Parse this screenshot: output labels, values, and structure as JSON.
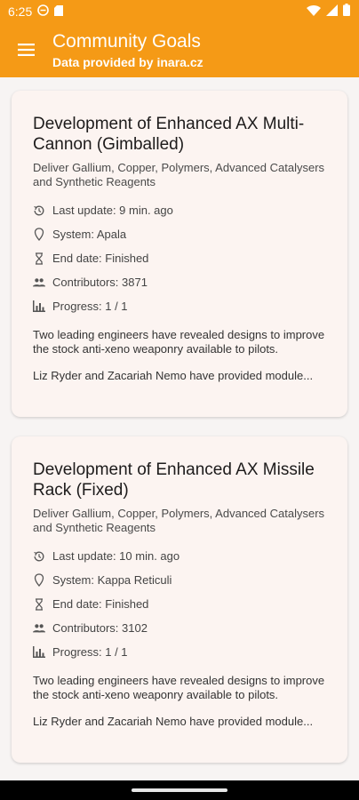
{
  "status": {
    "time": "6:25"
  },
  "header": {
    "title": "Community Goals",
    "subtitle": "Data provided by inara.cz"
  },
  "colors": {
    "accent": "#f59a16",
    "card": "#fcf4f1"
  },
  "goals": [
    {
      "title": "Development of Enhanced AX Multi-Cannon (Gimballed)",
      "description": "Deliver Gallium, Copper, Polymers, Advanced Catalysers and Synthetic Reagents",
      "last_update": "Last update: 9 min. ago",
      "system": "System: Apala",
      "end_date": "End date: Finished",
      "contributors": "Contributors: 3871",
      "progress": "Progress: 1 / 1",
      "body": "Two leading engineers have revealed designs to improve the stock anti-xeno weaponry available to pilots.",
      "body2": "Liz Ryder and Zacariah Nemo have provided module..."
    },
    {
      "title": "Development of Enhanced AX Missile Rack (Fixed)",
      "description": "Deliver Gallium, Copper, Polymers, Advanced Catalysers and Synthetic Reagents",
      "last_update": "Last update: 10 min. ago",
      "system": "System: Kappa Reticuli",
      "end_date": "End date: Finished",
      "contributors": "Contributors: 3102",
      "progress": "Progress: 1 / 1",
      "body": "Two leading engineers have revealed designs to improve the stock anti-xeno weaponry available to pilots.",
      "body2": "Liz Ryder and Zacariah Nemo have provided module..."
    }
  ]
}
